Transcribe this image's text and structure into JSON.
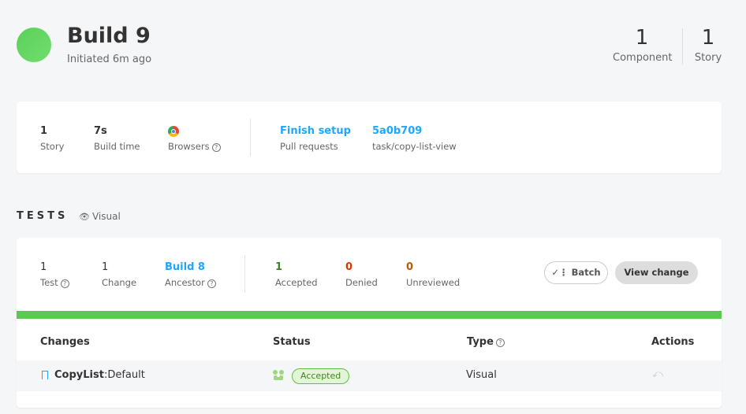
{
  "header": {
    "title": "Build 9",
    "subtitle": "Initiated 6m ago",
    "stats": [
      {
        "value": "1",
        "label": "Component"
      },
      {
        "value": "1",
        "label": "Story"
      }
    ]
  },
  "summary": {
    "story": {
      "value": "1",
      "label": "Story"
    },
    "build_time": {
      "value": "7s",
      "label": "Build time"
    },
    "browsers": {
      "label": "Browsers",
      "icon": "chrome-icon"
    },
    "pull_requests": {
      "value": "Finish setup",
      "label": "Pull requests"
    },
    "commit": {
      "value": "5a0b709",
      "label": "task/copy-list-view"
    }
  },
  "tests": {
    "heading": "TESTS",
    "tag": "Visual",
    "test": {
      "value": "1",
      "label": "Test"
    },
    "change": {
      "value": "1",
      "label": "Change"
    },
    "ancestor": {
      "value": "Build 8",
      "label": "Ancestor"
    },
    "accepted": {
      "value": "1",
      "label": "Accepted"
    },
    "denied": {
      "value": "0",
      "label": "Denied"
    },
    "unreviewed": {
      "value": "0",
      "label": "Unreviewed"
    },
    "batch_label": "Batch",
    "view_change_label": "View change",
    "progress_fraction": 1.0
  },
  "table": {
    "headers": {
      "changes": "Changes",
      "status": "Status",
      "type": "Type",
      "actions": "Actions"
    },
    "rows": [
      {
        "component": "CopyList",
        "story": "Default",
        "status": "Accepted",
        "type": "Visual"
      }
    ]
  },
  "colors": {
    "accent": "#1ea7fd",
    "success": "#5bc850",
    "denied": "#d43900",
    "unreviewed": "#b85c00"
  }
}
